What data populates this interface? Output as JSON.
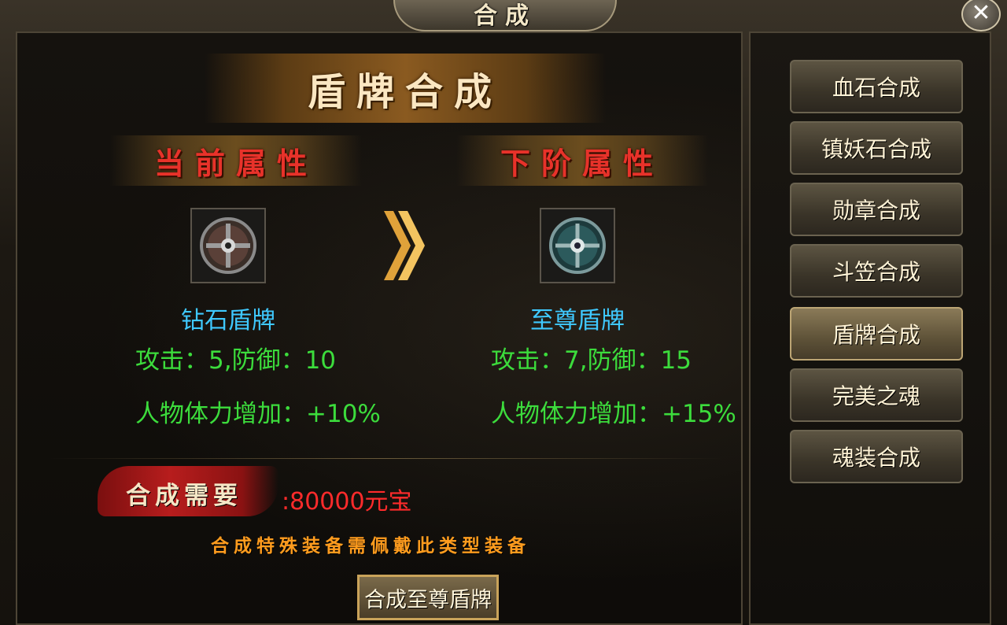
{
  "window": {
    "title": "合成"
  },
  "header": {
    "title": "盾牌合成"
  },
  "current": {
    "heading": "当前属性",
    "item_name": "钻石盾牌",
    "stat_line1": "攻击：5,防御：10",
    "stat_line2": "人物体力增加：+10%"
  },
  "next": {
    "heading": "下阶属性",
    "item_name": "至尊盾牌",
    "stat_line1": "攻击：7,防御：15",
    "stat_line2": "人物体力增加：+15%"
  },
  "requirement": {
    "label": "合成需要",
    "value": ":80000元宝"
  },
  "note": "合成特殊装备需佩戴此类型装备",
  "compose_button": "合成至尊盾牌",
  "sidebar": {
    "items": [
      {
        "label": "血石合成"
      },
      {
        "label": "镇妖石合成"
      },
      {
        "label": "勋章合成"
      },
      {
        "label": "斗笠合成"
      },
      {
        "label": "盾牌合成",
        "active": true
      },
      {
        "label": "完美之魂"
      },
      {
        "label": "魂装合成"
      }
    ]
  },
  "icons": {
    "close": "close-icon",
    "arrow": "double-chevron-right-icon",
    "current_item": "round-shield-icon",
    "next_item": "round-shield-icon"
  },
  "colors": {
    "item_name": "#3fc9ff",
    "stat": "#3cdc3c",
    "heading_red": "#e8322a",
    "cost": "#ff2b2b",
    "note": "#ff9c1e"
  }
}
